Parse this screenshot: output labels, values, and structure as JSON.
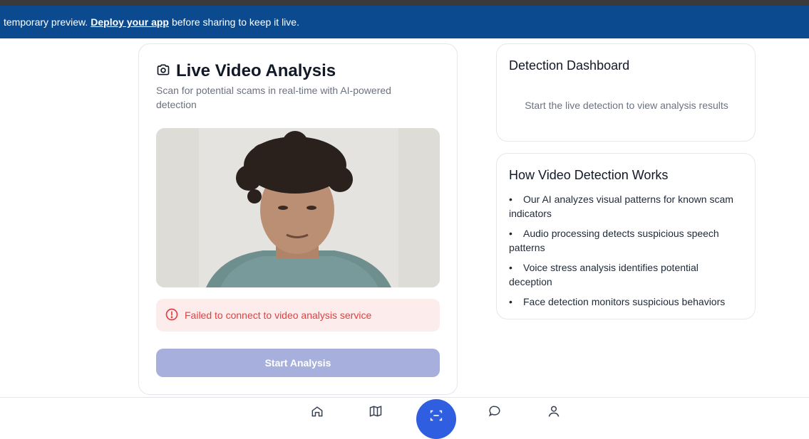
{
  "banner": {
    "before": "temporary preview.",
    "link": "Deploy your app",
    "after": "before sharing to keep it live."
  },
  "analysis": {
    "title": "Live Video Analysis",
    "subtitle": "Scan for potential scams in real-time with AI-powered detection",
    "error": "Failed to connect to video analysis service",
    "start_button": "Start Analysis"
  },
  "dashboard": {
    "title": "Detection Dashboard",
    "message": "Start the live detection to view analysis results"
  },
  "how": {
    "title": "How Video Detection Works",
    "items": [
      "Our AI analyzes visual patterns for known scam indicators",
      "Audio processing detects suspicious speech patterns",
      "Voice stress analysis identifies potential deception",
      "Face detection monitors suspicious behaviors"
    ]
  },
  "nav": {
    "icons": [
      "home-icon",
      "map-icon",
      "scan-icon",
      "chat-icon",
      "user-icon"
    ]
  },
  "colors": {
    "banner": "#0b4a8f",
    "error_bg": "#fdecec",
    "error_text": "#e53e3e",
    "button_disabled": "#a7b0dd",
    "nav_active": "#2f5fe0"
  }
}
